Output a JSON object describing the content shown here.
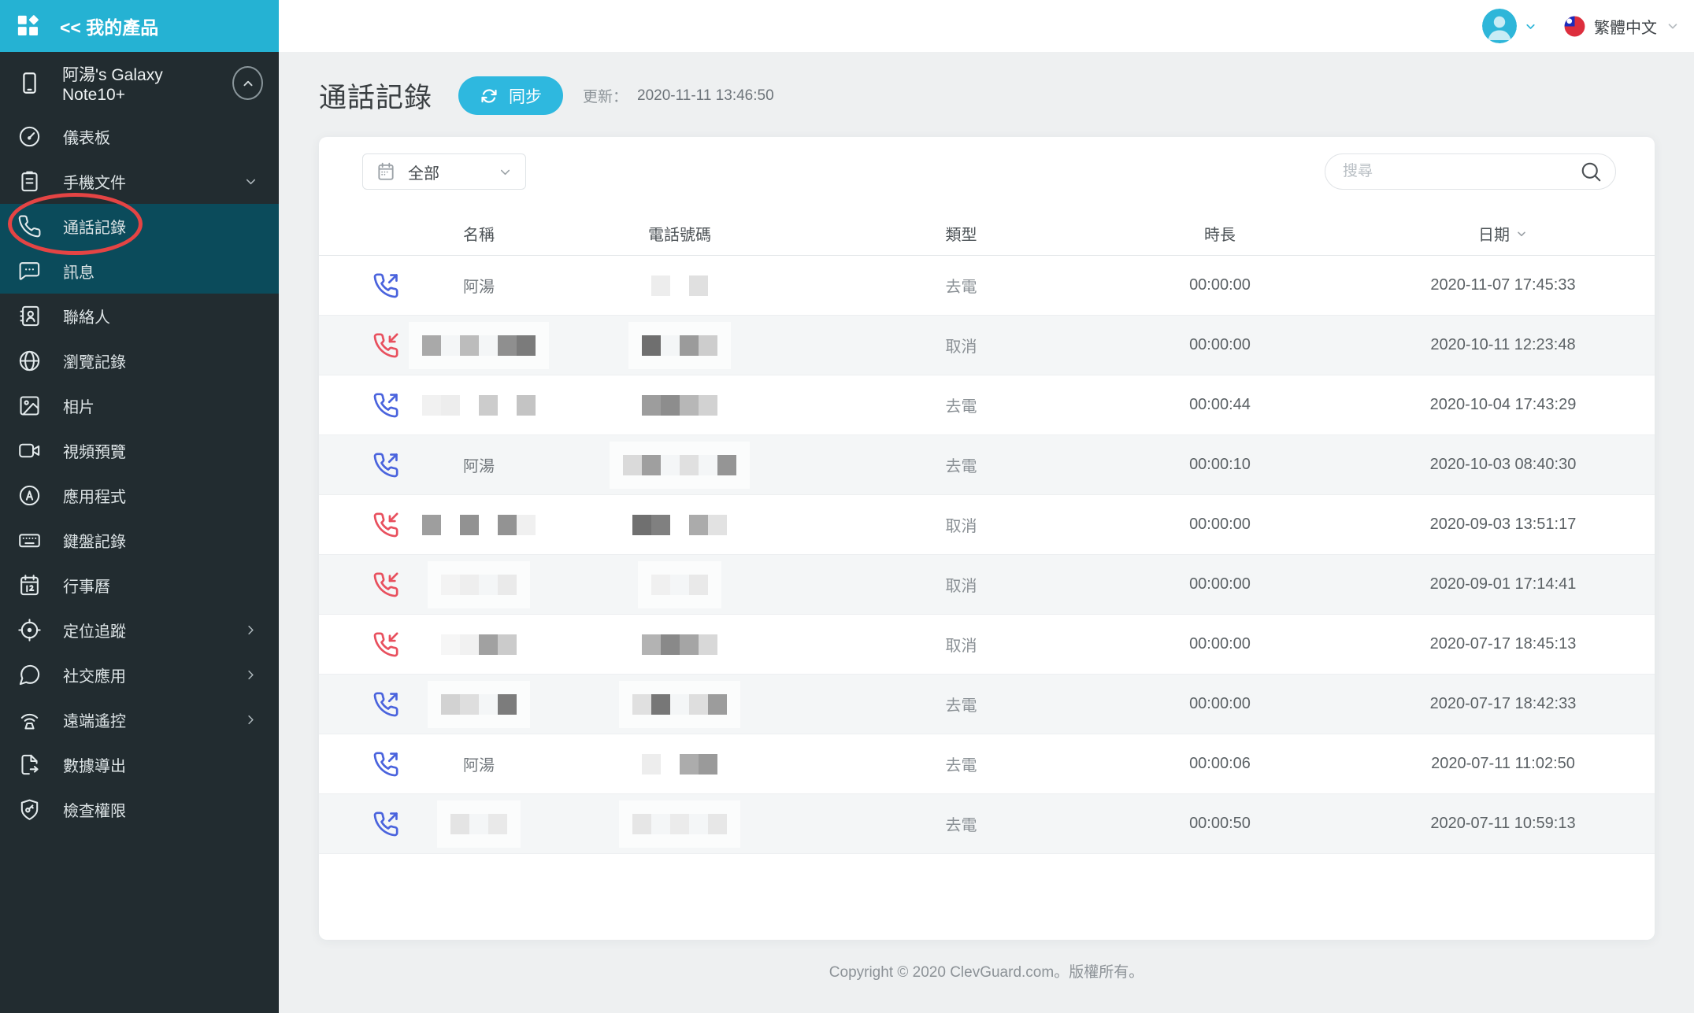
{
  "sidebar": {
    "logo_label": "<< 我的產品",
    "device_name": "阿湯's Galaxy Note10+",
    "items": [
      {
        "label": "儀表板",
        "icon": "dashboard-icon",
        "chevron": ""
      },
      {
        "label": "手機文件",
        "icon": "files-icon",
        "chevron": "down"
      },
      {
        "label": "通話記錄",
        "icon": "phone-icon",
        "chevron": "",
        "active": true
      },
      {
        "label": "訊息",
        "icon": "message-icon",
        "chevron": "",
        "active": true
      },
      {
        "label": "聯絡人",
        "icon": "contacts-icon",
        "chevron": ""
      },
      {
        "label": "瀏覽記錄",
        "icon": "globe-icon",
        "chevron": ""
      },
      {
        "label": "相片",
        "icon": "photo-icon",
        "chevron": ""
      },
      {
        "label": "視頻預覽",
        "icon": "video-icon",
        "chevron": ""
      },
      {
        "label": "應用程式",
        "icon": "apps-icon",
        "chevron": ""
      },
      {
        "label": "鍵盤記錄",
        "icon": "keyboard-icon",
        "chevron": ""
      },
      {
        "label": "行事曆",
        "icon": "calendar-icon",
        "chevron": ""
      },
      {
        "label": "定位追蹤",
        "icon": "location-icon",
        "chevron": "right"
      },
      {
        "label": "社交應用",
        "icon": "social-icon",
        "chevron": "right"
      },
      {
        "label": "遠端遙控",
        "icon": "remote-icon",
        "chevron": "right"
      },
      {
        "label": "數據導出",
        "icon": "export-icon",
        "chevron": ""
      },
      {
        "label": "檢查權限",
        "icon": "permission-icon",
        "chevron": ""
      }
    ]
  },
  "topbar": {
    "language": "繁體中文"
  },
  "page": {
    "title": "通話記錄",
    "sync_label": "同步",
    "updated_label": "更新：",
    "updated_time": "2020-11-11 13:46:50"
  },
  "toolbar": {
    "filter_value": "全部",
    "search_placeholder": "搜尋"
  },
  "table": {
    "headers": [
      "名稱",
      "電話號碼",
      "類型",
      "時長",
      "日期"
    ],
    "rows": [
      {
        "direction": "outgoing",
        "name": "阿湯",
        "name_mosaic": null,
        "number_mosaic": [
          "#ededed",
          "t",
          "#e0e0e0"
        ],
        "type": "去電",
        "duration": "00:00:00",
        "date": "2020-11-07 17:45:33"
      },
      {
        "direction": "incoming",
        "name": "",
        "name_mosaic": [
          "#a9a9a9",
          "t",
          "#bcbcbc",
          "t",
          "#8f8f8f",
          "#7b7b7b"
        ],
        "number_mosaic": [
          "#6f6f6f",
          "t",
          "#9b9b9b",
          "#cdcdcd"
        ],
        "type": "取消",
        "duration": "00:00:00",
        "date": "2020-10-11 12:23:48"
      },
      {
        "direction": "outgoing",
        "name": "",
        "name_mosaic": [
          "#f1f1f1",
          "#ededed",
          "t",
          "#cccccc",
          "t",
          "#c4c4c4"
        ],
        "number_mosaic": [
          "#9d9d9d",
          "#8d8d8d",
          "#b7b7b7",
          "#d2d2d2"
        ],
        "type": "去電",
        "duration": "00:00:44",
        "date": "2020-10-04 17:43:29"
      },
      {
        "direction": "outgoing",
        "name": "阿湯",
        "name_mosaic": null,
        "number_mosaic": [
          "#dadada",
          "#9f9f9f",
          "t",
          "#e0e0e0",
          "t",
          "#959595"
        ],
        "type": "去電",
        "duration": "00:00:10",
        "date": "2020-10-03 08:40:30"
      },
      {
        "direction": "incoming",
        "name": "",
        "name_mosaic": [
          "#9e9e9e",
          "t",
          "#929292",
          "t",
          "#939393",
          "#f0f0f0"
        ],
        "number_mosaic": [
          "#707070",
          "#808080",
          "t",
          "#ababab",
          "#e2e2e2"
        ],
        "type": "取消",
        "duration": "00:00:00",
        "date": "2020-09-03 13:51:17"
      },
      {
        "direction": "incoming",
        "name": "",
        "name_mosaic": [
          "#f3f3f3",
          "#eeeeee",
          "t",
          "#eaeaea"
        ],
        "number_mosaic": [
          "#f0f0f0",
          "t",
          "#e9e9e9"
        ],
        "type": "取消",
        "duration": "00:00:00",
        "date": "2020-09-01 17:14:41"
      },
      {
        "direction": "incoming",
        "name": "",
        "name_mosaic": [
          "#f6f6f6",
          "#f1f1f1",
          "#a1a1a1",
          "#cbcbcb"
        ],
        "number_mosaic": [
          "#b3b3b3",
          "#898989",
          "#a5a5a5",
          "#d8d8d8"
        ],
        "type": "取消",
        "duration": "00:00:00",
        "date": "2020-07-17 18:45:13"
      },
      {
        "direction": "outgoing",
        "name": "",
        "name_mosaic": [
          "#d2d2d2",
          "#dedede",
          "t",
          "#7c7c7c"
        ],
        "number_mosaic": [
          "#e0e0e0",
          "#777777",
          "t",
          "#dedede",
          "#9c9c9c"
        ],
        "type": "去電",
        "duration": "00:00:00",
        "date": "2020-07-17 18:42:33"
      },
      {
        "direction": "outgoing",
        "name": "阿湯",
        "name_mosaic": null,
        "number_mosaic": [
          "#ededed",
          "t",
          "#acacac",
          "#9a9a9a"
        ],
        "type": "去電",
        "duration": "00:00:06",
        "date": "2020-07-11 11:02:50"
      },
      {
        "direction": "outgoing",
        "name": "",
        "name_mosaic": [
          "#e4e4e4",
          "t",
          "#e9e9e9"
        ],
        "number_mosaic": [
          "#e6e6e6",
          "t",
          "#ebebeb",
          "t",
          "#e7e7e7"
        ],
        "type": "去電",
        "duration": "00:00:50",
        "date": "2020-07-11 10:59:13"
      }
    ]
  },
  "footer": {
    "copyright": "Copyright © 2020 ClevGuard.com。版權所有。"
  },
  "colors": {
    "accent_cyan": "#25b2d3",
    "sync_button": "#2eb8df",
    "sidebar_bg": "#222c30",
    "active_item_bg": "#0b4b5b",
    "annotation_red": "#e54444",
    "outgoing_icon": "#4a63dd",
    "incoming_icon": "#e8505e",
    "stripe_row": "#f4f6f7"
  }
}
